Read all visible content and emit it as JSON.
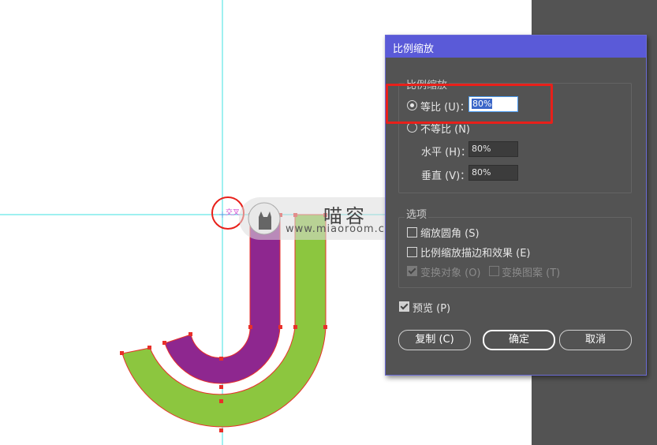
{
  "canvas": {
    "smart_guide_label": "交叉",
    "colors": {
      "purple": "#8e278f",
      "green": "#8cc63f",
      "guide": "#3fe0e0",
      "selection": "#e8302a"
    }
  },
  "watermark": {
    "chinese": "喵容",
    "url": "www.miaoroom.com",
    "icon": "cat-icon"
  },
  "dialog": {
    "title": "比例缩放",
    "scale_group": {
      "title": "比例缩放",
      "uniform": {
        "label": "等比 (U)：",
        "value": "80%",
        "checked": true
      },
      "non_uniform": {
        "label": "不等比 (N)",
        "checked": false
      },
      "horizontal": {
        "label": "水平 (H)：",
        "value": "80%"
      },
      "vertical": {
        "label": "垂直 (V)：",
        "value": "80%"
      }
    },
    "options_group": {
      "title": "选项",
      "scale_corners": {
        "label": "缩放圆角 (S)",
        "checked": false
      },
      "scale_strokes": {
        "label": "比例缩放描边和效果 (E)",
        "checked": false
      },
      "transform_objects": {
        "label": "变换对象 (O)",
        "checked": true,
        "disabled": true
      },
      "transform_patterns": {
        "label": "变换图案 (T)",
        "checked": false,
        "disabled": true
      }
    },
    "preview": {
      "label": "预览 (P)",
      "checked": true
    },
    "buttons": {
      "copy": "复制 (C)",
      "ok": "确定",
      "cancel": "取消"
    }
  }
}
